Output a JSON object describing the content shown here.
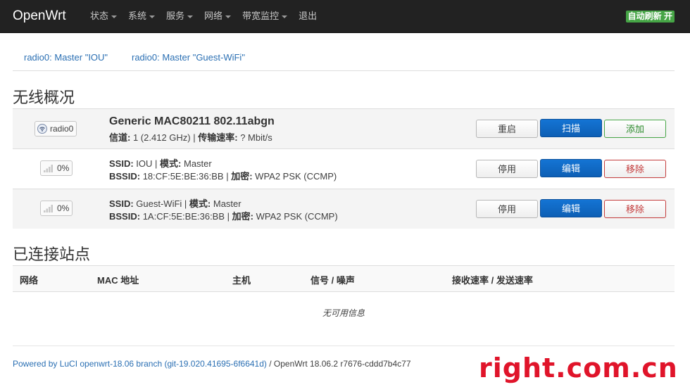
{
  "brand": "OpenWrt",
  "nav": [
    {
      "label": "状态",
      "dropdown": true
    },
    {
      "label": "系统",
      "dropdown": true
    },
    {
      "label": "服务",
      "dropdown": true
    },
    {
      "label": "网络",
      "dropdown": true
    },
    {
      "label": "带宽监控",
      "dropdown": true
    },
    {
      "label": "退出",
      "dropdown": false
    }
  ],
  "autorefresh": "自动刷新 开",
  "tabs": [
    "radio0: Master \"IOU\"",
    "radio0: Master \"Guest-WiFi\""
  ],
  "wireless": {
    "heading": "无线概况",
    "device": {
      "badge": "radio0",
      "name": "Generic MAC80211 802.11abgn",
      "channel_label": "信道:",
      "channel_value": "1 (2.412 GHz)",
      "rate_label": "传输速率:",
      "rate_value": "? Mbit/s",
      "buttons": {
        "restart": "重启",
        "scan": "扫描",
        "add": "添加"
      }
    },
    "networks": [
      {
        "signal": "0%",
        "ssid_label": "SSID:",
        "ssid": "IOU",
        "mode_label": "模式:",
        "mode": "Master",
        "bssid_label": "BSSID:",
        "bssid": "18:CF:5E:BE:36:BB",
        "enc_label": "加密:",
        "enc": "WPA2 PSK (CCMP)",
        "buttons": {
          "disable": "停用",
          "edit": "编辑",
          "remove": "移除"
        }
      },
      {
        "signal": "0%",
        "ssid_label": "SSID:",
        "ssid": "Guest-WiFi",
        "mode_label": "模式:",
        "mode": "Master",
        "bssid_label": "BSSID:",
        "bssid": "1A:CF:5E:BE:36:BB",
        "enc_label": "加密:",
        "enc": "WPA2 PSK (CCMP)",
        "buttons": {
          "disable": "停用",
          "edit": "编辑",
          "remove": "移除"
        }
      }
    ]
  },
  "assoc": {
    "heading": "已连接站点",
    "columns": [
      "网络",
      "MAC 地址",
      "主机",
      "信号 / 噪声",
      "接收速率 / 发送速率"
    ],
    "empty": "无可用信息"
  },
  "footer": {
    "link": "Powered by LuCI openwrt-18.06 branch (git-19.020.41695-6f6641d)",
    "rest": " / OpenWrt 18.06.2 r7676-cddd7b4c77"
  },
  "watermark": "right.com.cn",
  "colors": {
    "navbar": "#222222",
    "primary": "#0d66c2",
    "success": "#46a546",
    "danger": "#c43c3c",
    "link": "#2a6fb3",
    "watermark": "#e0142a"
  }
}
